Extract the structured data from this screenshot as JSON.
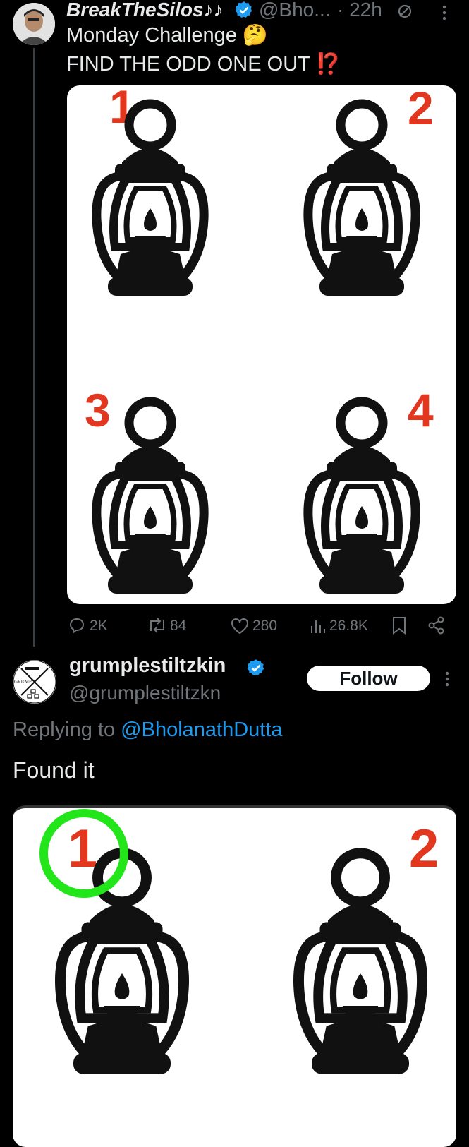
{
  "post": {
    "display_name": "BreakTheSilos♪♪",
    "handle": "@Bho...",
    "time": "· 22h",
    "line1": "Monday Challenge",
    "line1_emoji": "🤔",
    "line2": "FIND THE ODD ONE OUT",
    "line2_emoji": "⁉️",
    "image_numbers": [
      "1",
      "2",
      "3",
      "4"
    ],
    "stats": {
      "replies": "2K",
      "reposts": "84",
      "likes": "280",
      "views": "26.8K"
    }
  },
  "reply": {
    "display_name": "grumplestiltzkin",
    "handle": "@grumplestiltzkn",
    "follow_label": "Follow",
    "replying_prefix": "Replying to",
    "replying_handle": "@BholanathDutta",
    "text": "Found it",
    "image_numbers": [
      "1",
      "2"
    ],
    "avatar_text": "GRUMP"
  },
  "colors": {
    "accent": "#1d9bf0",
    "number_red": "#e3361f",
    "circle_green": "#22e61a",
    "muted": "#71767b"
  },
  "icons": [
    "verified-badge-icon",
    "mute-icon",
    "more-icon",
    "reply-icon",
    "repost-icon",
    "like-icon",
    "views-icon",
    "bookmark-icon",
    "share-icon"
  ]
}
